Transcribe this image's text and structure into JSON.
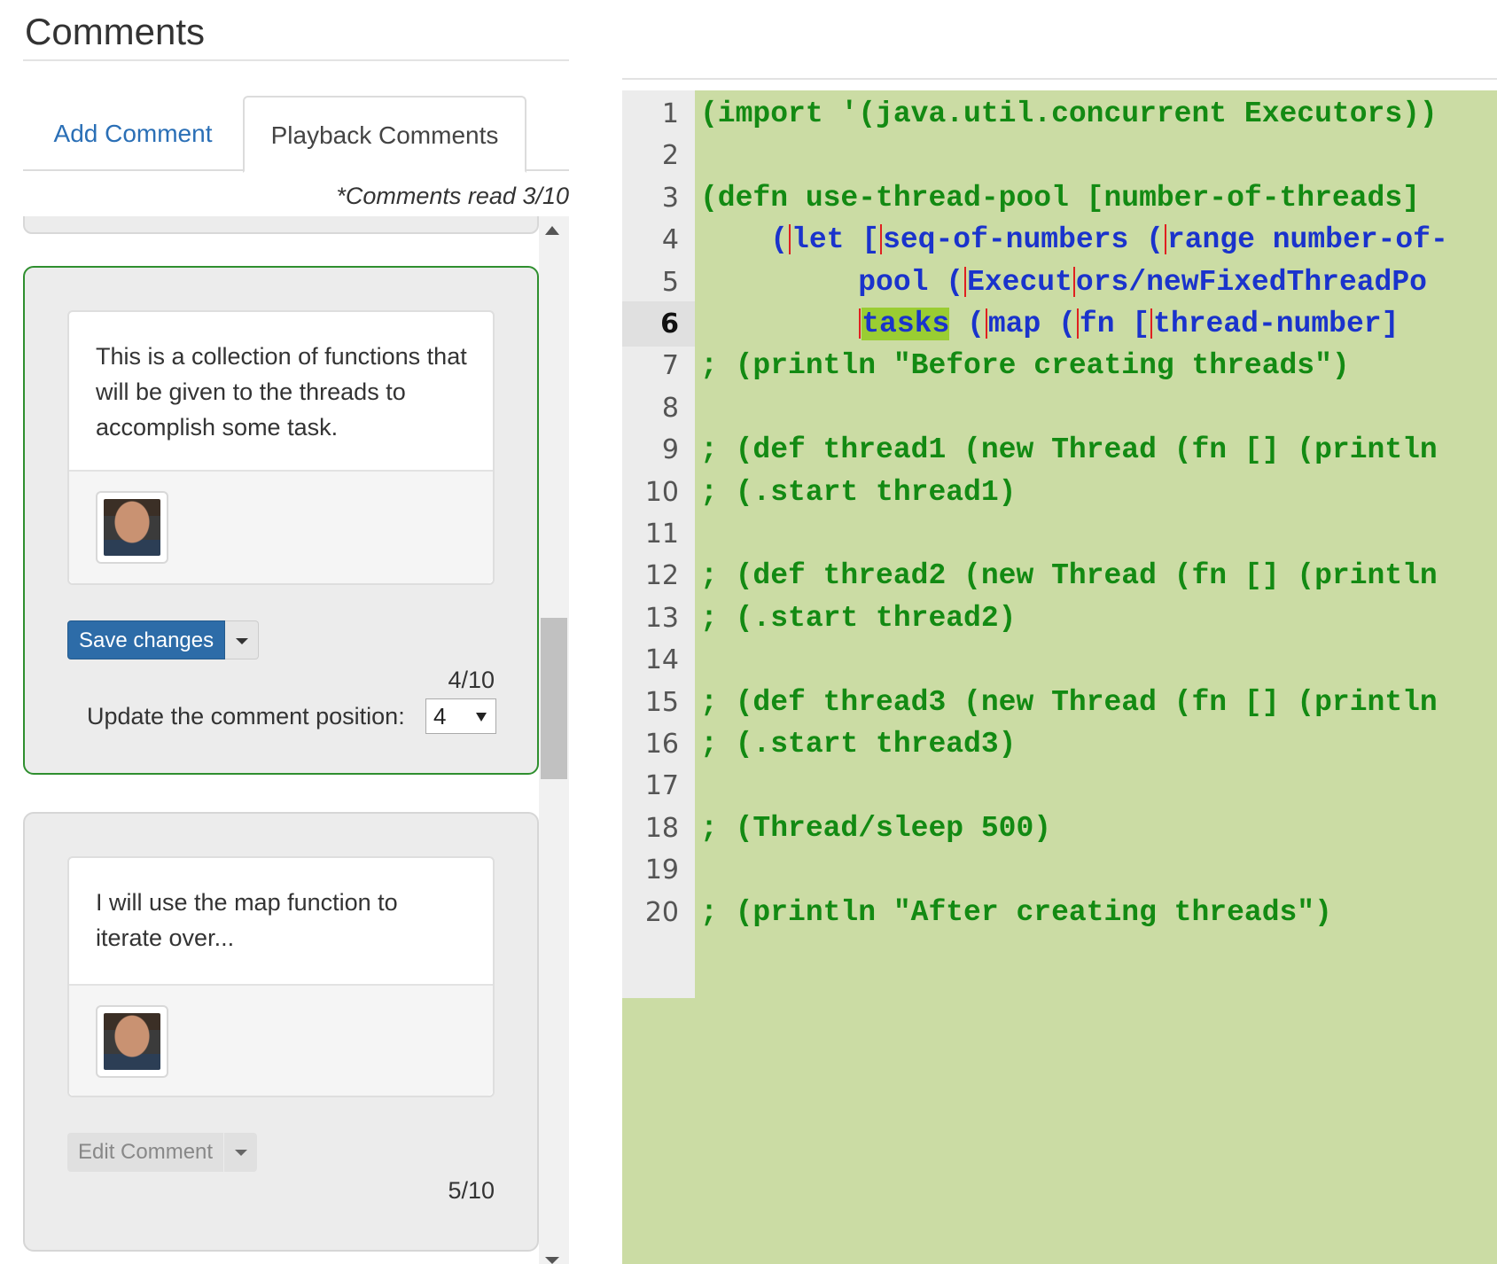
{
  "panel": {
    "title": "Comments",
    "tabs": [
      {
        "label": "Add Comment"
      },
      {
        "label": "Playback Comments"
      }
    ],
    "comments_read": "*Comments read 3/10"
  },
  "comments": [
    {
      "text": "This is a collection of functions that will be given to the threads to accomplish some task.",
      "button_label": "Save changes",
      "position_text": "4/10",
      "update_label": "Update the comment position:",
      "position_select_value": "4"
    },
    {
      "text": "I will use the map function to iterate over...",
      "button_label": "Edit Comment",
      "position_text": "5/10"
    }
  ],
  "editor": {
    "current_line": 6,
    "colors": {
      "background": "#cbdca4",
      "keyword_green": "#138a13",
      "highlight_blue": "#1a33cc",
      "selection": "#9acd32"
    },
    "lines": [
      {
        "n": "1",
        "segments": [
          {
            "t": "(import '(java.util.concurrent Executors))",
            "c": "g"
          }
        ]
      },
      {
        "n": "2",
        "segments": []
      },
      {
        "n": "3",
        "segments": [
          {
            "t": "(defn use-thread-pool [number-of-threads]",
            "c": "g"
          }
        ]
      },
      {
        "n": "4",
        "segments": [
          {
            "t": "    (",
            "c": "b"
          },
          {
            "cur": true
          },
          {
            "t": "let [",
            "c": "b"
          },
          {
            "cur": true
          },
          {
            "t": "seq-of-numbers (",
            "c": "b"
          },
          {
            "cur": true
          },
          {
            "t": "range number-of-",
            "c": "b"
          }
        ]
      },
      {
        "n": "5",
        "segments": [
          {
            "t": "         pool (",
            "c": "b"
          },
          {
            "cur": true
          },
          {
            "t": "Execut",
            "c": "b"
          },
          {
            "cur": true
          },
          {
            "t": "ors/newFixedThreadPo",
            "c": "b"
          }
        ]
      },
      {
        "n": "6",
        "segments": [
          {
            "t": "         ",
            "c": "b"
          },
          {
            "cur": true
          },
          {
            "t": "tasks",
            "c": "hl"
          },
          {
            "t": " (",
            "c": "b"
          },
          {
            "cur": true
          },
          {
            "t": "map (",
            "c": "b"
          },
          {
            "cur": true
          },
          {
            "t": "fn [",
            "c": "b"
          },
          {
            "cur": true
          },
          {
            "t": "thread-number]",
            "c": "b"
          }
        ]
      },
      {
        "n": "7",
        "segments": [
          {
            "t": "; (println \"Before creating threads\")",
            "c": "g"
          }
        ]
      },
      {
        "n": "8",
        "segments": []
      },
      {
        "n": "9",
        "segments": [
          {
            "t": "; (def thread1 (new Thread (fn [] (println",
            "c": "g"
          }
        ]
      },
      {
        "n": "10",
        "segments": [
          {
            "t": "; (.start thread1)",
            "c": "g"
          }
        ]
      },
      {
        "n": "11",
        "segments": []
      },
      {
        "n": "12",
        "segments": [
          {
            "t": "; (def thread2 (new Thread (fn [] (println",
            "c": "g"
          }
        ]
      },
      {
        "n": "13",
        "segments": [
          {
            "t": "; (.start thread2)",
            "c": "g"
          }
        ]
      },
      {
        "n": "14",
        "segments": []
      },
      {
        "n": "15",
        "segments": [
          {
            "t": "; (def thread3 (new Thread (fn [] (println",
            "c": "g"
          }
        ]
      },
      {
        "n": "16",
        "segments": [
          {
            "t": "; (.start thread3)",
            "c": "g"
          }
        ]
      },
      {
        "n": "17",
        "segments": []
      },
      {
        "n": "18",
        "segments": [
          {
            "t": "; (Thread/sleep 500)",
            "c": "g"
          }
        ]
      },
      {
        "n": "19",
        "segments": []
      },
      {
        "n": "20",
        "segments": [
          {
            "t": "; (println \"After creating threads\")",
            "c": "g"
          }
        ]
      }
    ]
  }
}
